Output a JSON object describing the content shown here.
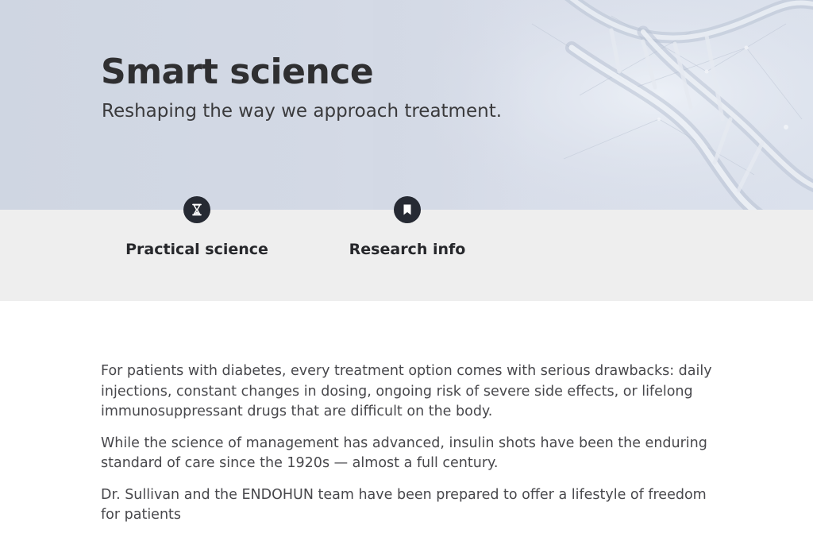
{
  "hero": {
    "title": "Smart science",
    "subtitle": "Reshaping the way we approach treatment."
  },
  "features": [
    {
      "label": "Practical science",
      "icon": "hourglass-icon"
    },
    {
      "label": "Research info",
      "icon": "bookmark-icon"
    }
  ],
  "content": {
    "paragraphs": [
      "For patients with diabetes, every treatment option comes with serious drawbacks: daily injections, constant changes in dosing, ongoing risk of severe side effects, or lifelong immunosuppressant drugs that are difficult on the body.",
      "While the science of management has advanced, insulin shots have been the enduring standard of care since the 1920s — almost a full century.",
      "Dr. Sullivan and the ENDOHUN team have been prepared to offer a lifestyle of freedom for patients"
    ]
  },
  "colors": {
    "hero_background": "#d3d9e5",
    "band_background": "#eeeeee",
    "icon_circle": "#262a33",
    "heading_text": "#2f2f31",
    "body_text": "#48484c"
  }
}
